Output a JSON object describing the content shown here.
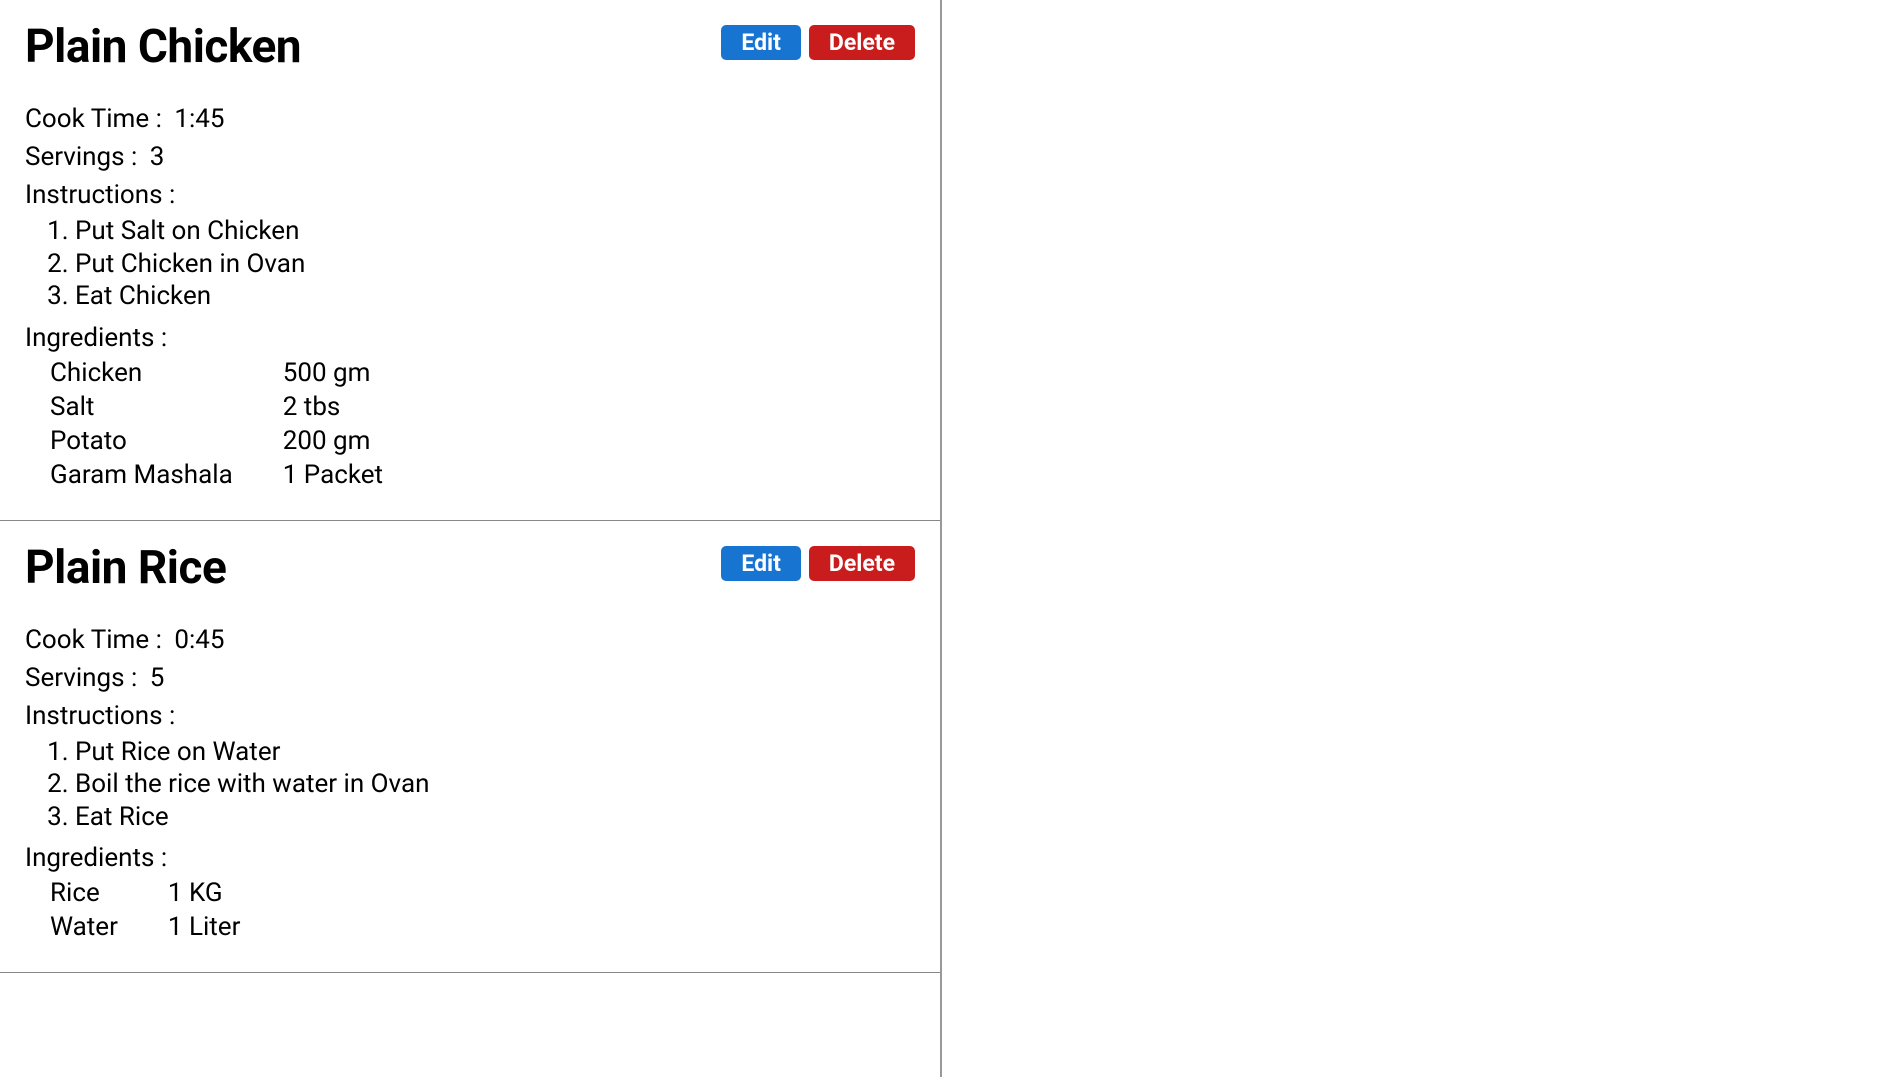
{
  "labels": {
    "edit": "Edit",
    "delete": "Delete",
    "cook_time": "Cook Time :",
    "servings": "Servings :",
    "instructions": "Instructions :",
    "ingredients": "Ingredients :"
  },
  "recipes": [
    {
      "title": "Plain Chicken",
      "cook_time": "1:45",
      "servings": "3",
      "instructions": [
        "Put Salt on Chicken",
        "Put Chicken in Ovan",
        "Eat Chicken"
      ],
      "ingredients": [
        {
          "name": "Chicken",
          "amount": "500 gm"
        },
        {
          "name": "Salt",
          "amount": "2 tbs"
        },
        {
          "name": "Potato",
          "amount": "200 gm"
        },
        {
          "name": "Garam Mashala",
          "amount": "1 Packet"
        }
      ]
    },
    {
      "title": "Plain Rice",
      "cook_time": "0:45",
      "servings": "5",
      "instructions": [
        "Put Rice on Water",
        "Boil the rice with water in Ovan",
        "Eat Rice"
      ],
      "ingredients": [
        {
          "name": "Rice",
          "amount": "1 KG"
        },
        {
          "name": "Water",
          "amount": "1 Liter"
        }
      ]
    }
  ]
}
